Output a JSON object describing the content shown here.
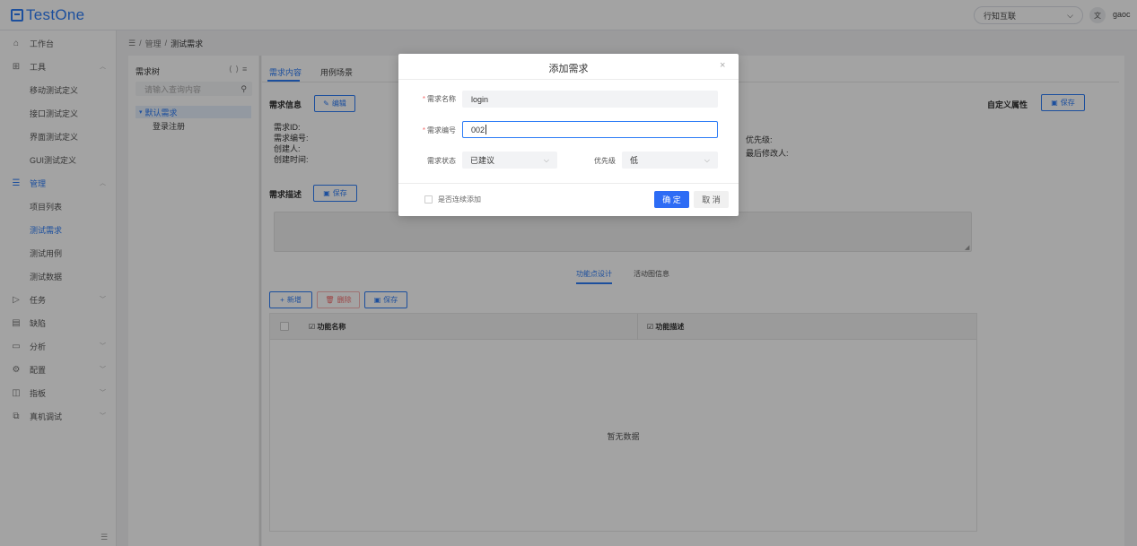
{
  "header": {
    "logo_text": "TestOne",
    "org_selector": "行知互联",
    "lang_icon": "文",
    "user": "gaoc"
  },
  "sidebar": {
    "items": [
      {
        "label": "工作台",
        "icon": "home-icon"
      },
      {
        "label": "工具",
        "icon": "grid-icon"
      },
      {
        "label": "移动测试定义"
      },
      {
        "label": "接口测试定义"
      },
      {
        "label": "界面测试定义"
      },
      {
        "label": "GUI测试定义"
      },
      {
        "label": "管理",
        "icon": "list-icon"
      },
      {
        "label": "项目列表"
      },
      {
        "label": "测试需求"
      },
      {
        "label": "测试用例"
      },
      {
        "label": "测试数据"
      },
      {
        "label": "任务",
        "icon": "play-icon"
      },
      {
        "label": "缺陷",
        "icon": "doc-icon"
      },
      {
        "label": "分析",
        "icon": "chart-icon"
      },
      {
        "label": "配置",
        "icon": "gear-icon"
      },
      {
        "label": "指板",
        "icon": "panel-icon"
      },
      {
        "label": "真机调试",
        "icon": "device-icon"
      }
    ]
  },
  "breadcrumb": {
    "items": [
      "管理",
      "测试需求"
    ]
  },
  "tree": {
    "title": "需求树",
    "search_placeholder": "请输入查询内容",
    "root": "默认需求",
    "child": "登录注册"
  },
  "main": {
    "tabs": [
      "需求内容",
      "用例场景"
    ],
    "info_title": "需求信息",
    "edit_btn": "编辑",
    "fields": {
      "id": "需求ID:",
      "code": "需求编号:",
      "creator": "创建人:",
      "created": "创建时间:",
      "priority": "优先级:",
      "modifier": "最后修改人:"
    },
    "desc_title": "需求描述",
    "save_btn": "保存",
    "subtabs": [
      "功能点设计",
      "活动图信息"
    ],
    "add_btn": "新增",
    "delete_btn": "删除",
    "table_save_btn": "保存",
    "columns": [
      "功能名称",
      "功能描述"
    ],
    "empty_text": "暂无数据",
    "custom_attr_title": "自定义属性",
    "custom_save_btn": "保存"
  },
  "dialog": {
    "title": "添加需求",
    "name_label": "需求名称",
    "name_value": "login",
    "code_label": "需求编号",
    "code_value": "002",
    "status_label": "需求状态",
    "status_value": "已建议",
    "priority_label": "优先级",
    "priority_value": "低",
    "continuous_label": "是否连续添加",
    "confirm": "确 定",
    "cancel": "取 消"
  }
}
